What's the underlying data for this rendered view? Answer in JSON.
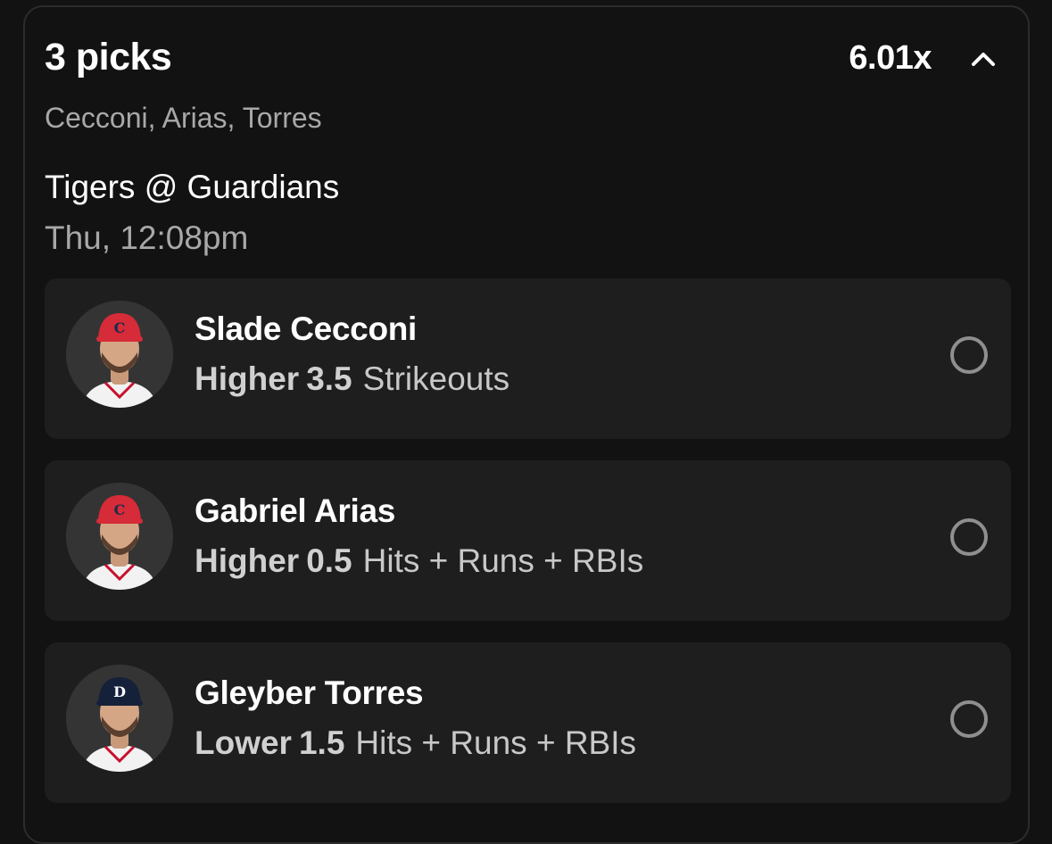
{
  "header": {
    "title": "3 picks",
    "multiplier": "6.01x",
    "players_summary": "Cecconi, Arias, Torres"
  },
  "game": {
    "matchup": "Tigers @ Guardians",
    "time": "Thu, 12:08pm"
  },
  "picks": [
    {
      "name": "Slade Cecconi",
      "direction": "Higher",
      "line": "3.5",
      "stat": "Strikeouts",
      "team_cap_color": "#d62b38",
      "cap_letter": "C",
      "cap_letter_color": "#1a2b4c",
      "selected": false
    },
    {
      "name": "Gabriel Arias",
      "direction": "Higher",
      "line": "0.5",
      "stat": "Hits + Runs + RBIs",
      "team_cap_color": "#d62b38",
      "cap_letter": "C",
      "cap_letter_color": "#1a2b4c",
      "selected": false
    },
    {
      "name": "Gleyber Torres",
      "direction": "Lower",
      "line": "1.5",
      "stat": "Hits + Runs + RBIs",
      "team_cap_color": "#15213b",
      "cap_letter": "D",
      "cap_letter_color": "#ffffff",
      "selected": false
    }
  ],
  "icons": {
    "collapse": "chevron-up-icon",
    "select": "radio-circle-icon"
  }
}
